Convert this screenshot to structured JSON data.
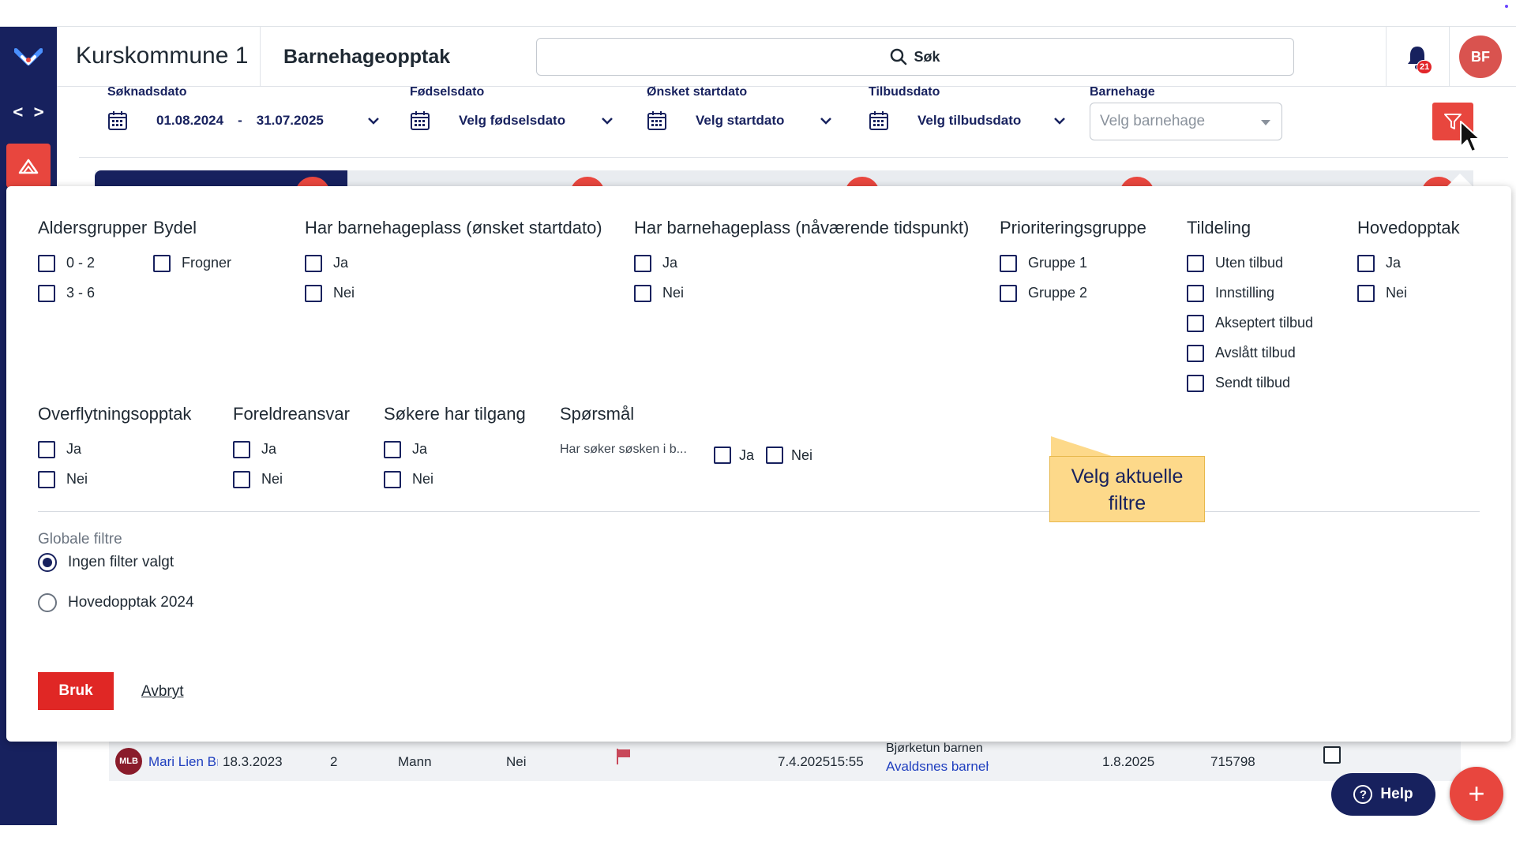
{
  "header": {
    "app_title": "Kurskommune 1",
    "module_title": "Barnehageopptak",
    "search_label": "Søk",
    "notification_count": "21",
    "avatar_initials": "BF"
  },
  "filterbar": {
    "soknadsdato": {
      "label": "Søknadsdato",
      "from": "01.08.2024",
      "sep": "-",
      "to": "31.07.2025"
    },
    "fodselsdato": {
      "label": "Fødselsdato",
      "value": "Velg fødselsdato"
    },
    "startdato": {
      "label": "Ønsket startdato",
      "value": "Velg startdato"
    },
    "tilbudsdato": {
      "label": "Tilbudsdato",
      "value": "Velg tilbudsdato"
    },
    "barnehage": {
      "label": "Barnehage",
      "placeholder": "Velg barnehage"
    }
  },
  "panel": {
    "groups_row1": [
      {
        "heading": "Aldersgrupper",
        "options": [
          "0 - 2",
          "3 - 6"
        ]
      },
      {
        "heading": "Bydel",
        "options": [
          "Frogner"
        ]
      },
      {
        "heading": "Har barnehageplass (ønsket startdato)",
        "options": [
          "Ja",
          "Nei"
        ]
      },
      {
        "heading": "Har barnehageplass (nåværende tidspunkt)",
        "options": [
          "Ja",
          "Nei"
        ]
      },
      {
        "heading": "Prioriteringsgruppe",
        "options": [
          "Gruppe 1",
          "Gruppe 2"
        ]
      },
      {
        "heading": "Tildeling",
        "options": [
          "Uten tilbud",
          "Innstilling",
          "Akseptert tilbud",
          "Avslått tilbud",
          "Sendt tilbud"
        ]
      },
      {
        "heading": "Hovedopptak",
        "options": [
          "Ja",
          "Nei"
        ]
      }
    ],
    "groups_row2": [
      {
        "heading": "Overflytningsopptak",
        "options": [
          "Ja",
          "Nei"
        ]
      },
      {
        "heading": "Foreldreansvar",
        "options": [
          "Ja",
          "Nei"
        ]
      },
      {
        "heading": "Søkere har tilgang",
        "options": [
          "Ja",
          "Nei"
        ]
      }
    ],
    "questions": {
      "heading": "Spørsmål",
      "question_text": "Har søker søsken i b...",
      "yes": "Ja",
      "no": "Nei"
    },
    "global": {
      "label": "Globale filtre",
      "options": [
        "Ingen filter valgt",
        "Hovedopptak 2024"
      ],
      "selected": "Ingen filter valgt"
    },
    "apply_label": "Bruk",
    "cancel_label": "Avbryt"
  },
  "tooltip": {
    "text": "Velg aktuelle filtre"
  },
  "table_row": {
    "initials": "MLB",
    "name": "Mari Lien Bı",
    "birth": "18.3.2023",
    "age": "2",
    "gender": "Mann",
    "has_place": "Nei",
    "applied": "7.4.202515:55",
    "kindergarten1": "Bjørketun barnen",
    "kindergarten2": "Avaldsnes barneh",
    "start": "1.8.2025",
    "id": "715798"
  },
  "help_label": "Help",
  "fab_label": "+",
  "colors": {
    "navy": "#17215e",
    "accent": "#e8463e",
    "tooltip": "#fdd98a"
  },
  "icons": [
    "logo-icon",
    "code-icon",
    "sign-icon",
    "search-icon",
    "bell-icon",
    "calendar-icon",
    "chevron-down-icon",
    "filter-icon",
    "cursor-icon",
    "flag-icon",
    "help-icon",
    "plus-icon"
  ]
}
